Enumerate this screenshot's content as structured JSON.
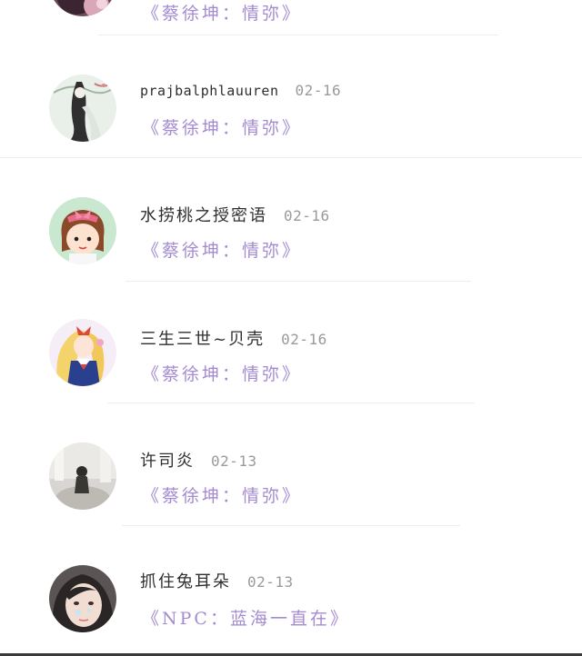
{
  "feed": {
    "items": [
      {
        "username": "",
        "date": "",
        "work": "《蔡徐坤：情弥》",
        "avatar": "partial-avatar"
      },
      {
        "username": "prajbalphlauuren",
        "date": "02-16",
        "work": "《蔡徐坤：情弥》",
        "avatar": "ink-painting-avatar"
      },
      {
        "username": "水捞桃之授密语",
        "date": "02-16",
        "work": "《蔡徐坤：情弥》",
        "avatar": "cartoon-girl-bow-avatar"
      },
      {
        "username": "三生三世~贝壳",
        "date": "02-16",
        "work": "《蔡徐坤：情弥》",
        "avatar": "anime-sailor-avatar"
      },
      {
        "username": "许司炎",
        "date": "02-13",
        "work": "《蔡徐坤：情弥》",
        "avatar": "silhouette-photo-avatar"
      },
      {
        "username": "抓住兔耳朵",
        "date": "02-13",
        "work": "《NPC：蓝海一直在》",
        "avatar": "girl-photo-avatar"
      }
    ]
  },
  "colors": {
    "work_title": "#a48bd1",
    "username": "#2e2e2e",
    "date": "#9a9a9a",
    "divider": "#eeeeee"
  }
}
